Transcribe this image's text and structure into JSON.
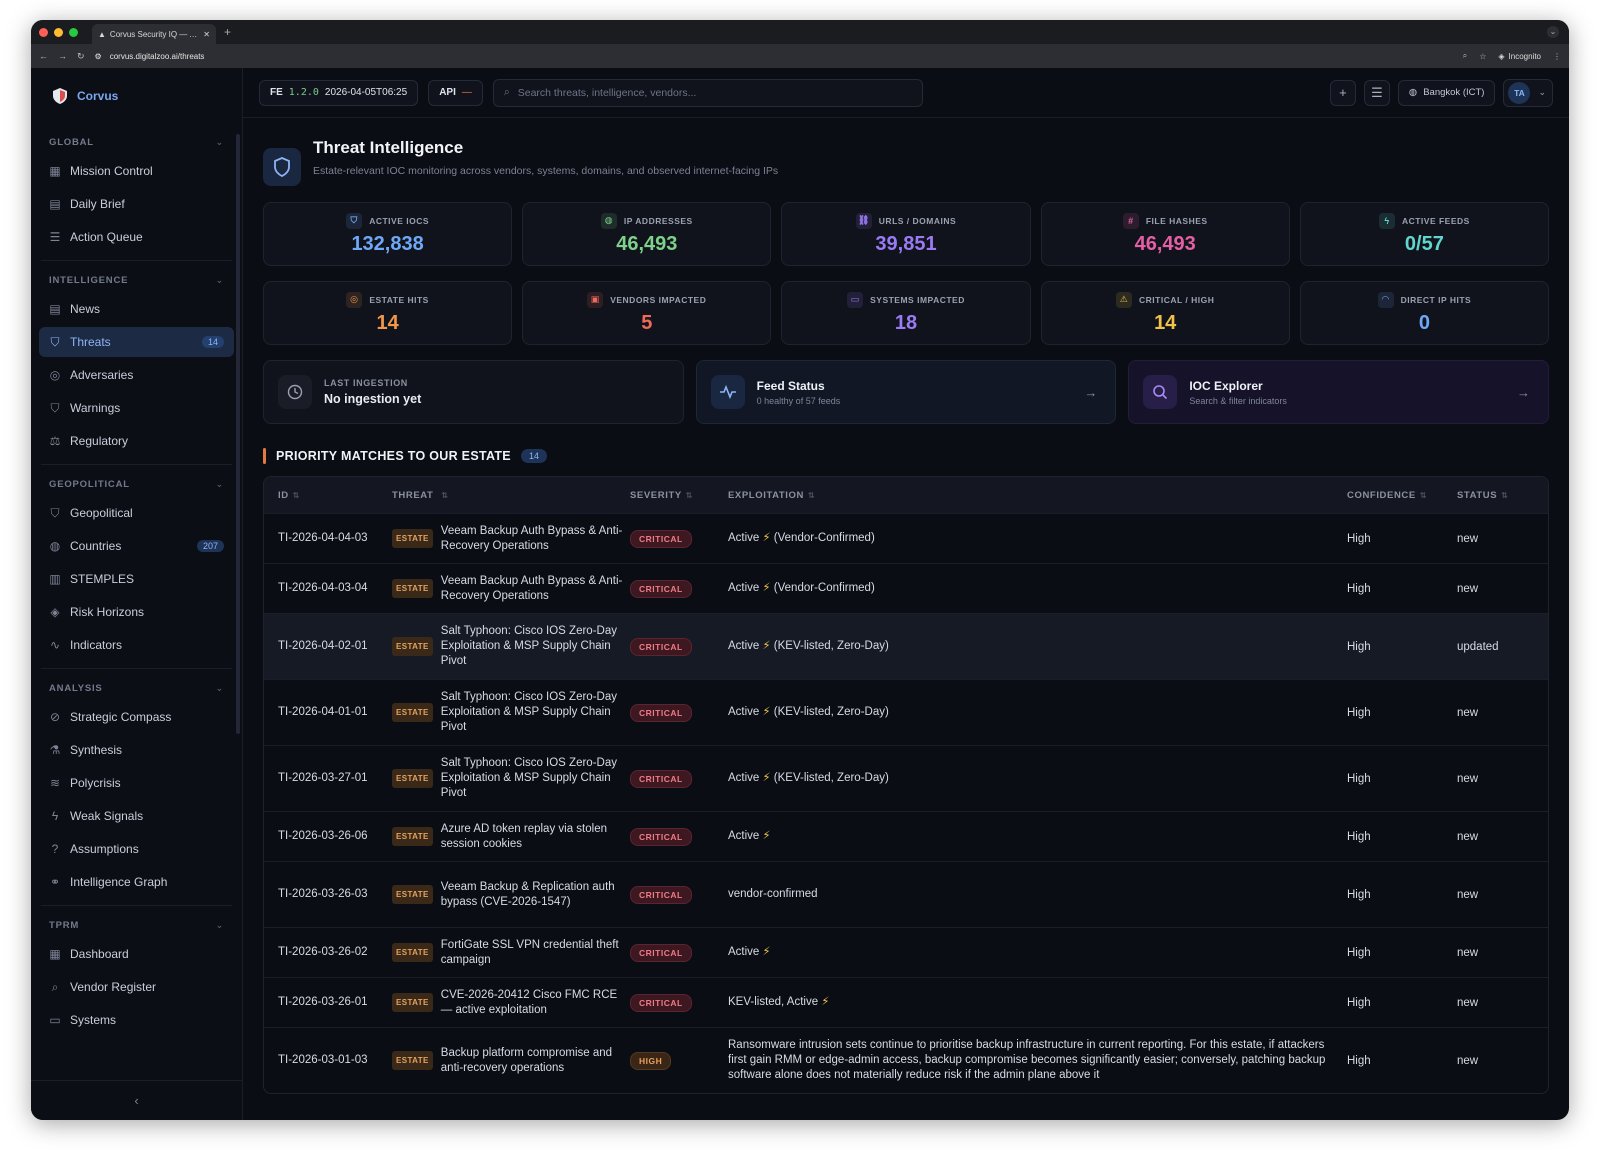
{
  "browser": {
    "tab_title": "Corvus Security IQ — AI-Pow...",
    "url": "corvus.digitalzoo.ai/threats",
    "incognito": "Incognito"
  },
  "brand": {
    "name": "Corvus"
  },
  "sidebar": {
    "sections": [
      {
        "title": "GLOBAL",
        "items": [
          {
            "label": "Mission Control",
            "icon": "grid-icon"
          },
          {
            "label": "Daily Brief",
            "icon": "document-icon"
          },
          {
            "label": "Action Queue",
            "icon": "list-icon"
          }
        ]
      },
      {
        "title": "INTELLIGENCE",
        "items": [
          {
            "label": "News",
            "icon": "newspaper-icon"
          },
          {
            "label": "Threats",
            "icon": "shield-icon",
            "badge": "14",
            "active": true
          },
          {
            "label": "Adversaries",
            "icon": "target-icon"
          },
          {
            "label": "Warnings",
            "icon": "shield-alert-icon"
          },
          {
            "label": "Regulatory",
            "icon": "scale-icon"
          }
        ]
      },
      {
        "title": "GEOPOLITICAL",
        "items": [
          {
            "label": "Geopolitical",
            "icon": "shield-icon"
          },
          {
            "label": "Countries",
            "icon": "globe-icon",
            "badge": "207"
          },
          {
            "label": "STEMPLES",
            "icon": "bar-chart-icon"
          },
          {
            "label": "Risk Horizons",
            "icon": "layers-icon"
          },
          {
            "label": "Indicators",
            "icon": "activity-icon"
          }
        ]
      },
      {
        "title": "ANALYSIS",
        "items": [
          {
            "label": "Strategic Compass",
            "icon": "compass-icon"
          },
          {
            "label": "Synthesis",
            "icon": "flask-icon"
          },
          {
            "label": "Polycrisis",
            "icon": "waves-icon"
          },
          {
            "label": "Weak Signals",
            "icon": "zap-icon"
          },
          {
            "label": "Assumptions",
            "icon": "help-circle-icon"
          },
          {
            "label": "Intelligence Graph",
            "icon": "network-icon"
          }
        ]
      },
      {
        "title": "TPRM",
        "items": [
          {
            "label": "Dashboard",
            "icon": "grid-icon"
          },
          {
            "label": "Vendor Register",
            "icon": "search-icon"
          },
          {
            "label": "Systems",
            "icon": "monitor-icon"
          }
        ]
      }
    ],
    "collapse_label": "‹"
  },
  "topbar": {
    "fe_label": "FE",
    "fe_version": "1.2.0",
    "fe_timestamp": "2026-04-05T06:25",
    "api_label": "API",
    "api_status": "—",
    "search_placeholder": "Search threats, intelligence, vendors...",
    "timezone": "Bangkok (ICT)",
    "user_initials": "TA"
  },
  "page": {
    "title": "Threat Intelligence",
    "subtitle": "Estate-relevant IOC monitoring across vendors, systems, domains, and observed internet-facing IPs"
  },
  "stats_row1": [
    {
      "label": "ACTIVE IOCS",
      "value": "132,838",
      "color": "#6ea8f7",
      "icon": "shield-icon"
    },
    {
      "label": "IP ADDRESSES",
      "value": "46,493",
      "color": "#7ed08b",
      "icon": "globe-icon"
    },
    {
      "label": "URLS / DOMAINS",
      "value": "39,851",
      "color": "#9b7bf5",
      "icon": "link-icon"
    },
    {
      "label": "FILE HASHES",
      "value": "46,493",
      "color": "#e45fa4",
      "icon": "hash-icon"
    },
    {
      "label": "ACTIVE FEEDS",
      "value": "0/57",
      "color": "#5fd6cf",
      "icon": "zap-icon"
    }
  ],
  "stats_row2": [
    {
      "label": "ESTATE HITS",
      "value": "14",
      "color": "#f2964b",
      "icon": "target-icon"
    },
    {
      "label": "VENDORS IMPACTED",
      "value": "5",
      "color": "#ef6a5a",
      "icon": "building-icon"
    },
    {
      "label": "SYSTEMS IMPACTED",
      "value": "18",
      "color": "#9b7bf5",
      "icon": "monitor-icon"
    },
    {
      "label": "CRITICAL / HIGH",
      "value": "14",
      "color": "#f0c24a",
      "icon": "warning-icon"
    },
    {
      "label": "DIRECT IP HITS",
      "value": "0",
      "color": "#6ea8f7",
      "icon": "wifi-icon"
    }
  ],
  "cards": {
    "ingestion": {
      "label": "LAST INGESTION",
      "value": "No ingestion yet"
    },
    "feed": {
      "title": "Feed Status",
      "subtitle": "0 healthy of 57 feeds"
    },
    "ioc": {
      "title": "IOC Explorer",
      "subtitle": "Search & filter indicators"
    }
  },
  "priority": {
    "title": "PRIORITY MATCHES TO OUR ESTATE",
    "count": "14",
    "columns": [
      "ID",
      "THREAT",
      "SEVERITY",
      "EXPLOITATION",
      "CONFIDENCE",
      "STATUS"
    ],
    "estate_tag": "ESTATE",
    "rows": [
      {
        "id": "TI-2026-04-04-03",
        "threat": "Veeam Backup Auth Bypass & Anti-Recovery Operations",
        "severity": "CRITICAL",
        "exploit": "Active ⚡ (Vendor-Confirmed)",
        "confidence": "High",
        "status": "new"
      },
      {
        "id": "TI-2026-04-03-04",
        "threat": "Veeam Backup Auth Bypass & Anti-Recovery Operations",
        "severity": "CRITICAL",
        "exploit": "Active ⚡ (Vendor-Confirmed)",
        "confidence": "High",
        "status": "new"
      },
      {
        "id": "TI-2026-04-02-01",
        "threat": "Salt Typhoon: Cisco IOS Zero-Day Exploitation & MSP Supply Chain Pivot",
        "severity": "CRITICAL",
        "exploit": "Active ⚡ (KEV-listed, Zero-Day)",
        "confidence": "High",
        "status": "updated"
      },
      {
        "id": "TI-2026-04-01-01",
        "threat": "Salt Typhoon: Cisco IOS Zero-Day Exploitation & MSP Supply Chain Pivot",
        "severity": "CRITICAL",
        "exploit": "Active ⚡ (KEV-listed, Zero-Day)",
        "confidence": "High",
        "status": "new"
      },
      {
        "id": "TI-2026-03-27-01",
        "threat": "Salt Typhoon: Cisco IOS Zero-Day Exploitation & MSP Supply Chain Pivot",
        "severity": "CRITICAL",
        "exploit": "Active ⚡ (KEV-listed, Zero-Day)",
        "confidence": "High",
        "status": "new"
      },
      {
        "id": "TI-2026-03-26-06",
        "threat": "Azure AD token replay via stolen session cookies",
        "severity": "CRITICAL",
        "exploit": "Active ⚡",
        "confidence": "High",
        "status": "new"
      },
      {
        "id": "TI-2026-03-26-03",
        "threat": "Veeam Backup & Replication auth bypass (CVE-2026-1547)",
        "severity": "CRITICAL",
        "exploit": "vendor-confirmed",
        "confidence": "High",
        "status": "new"
      },
      {
        "id": "TI-2026-03-26-02",
        "threat": "FortiGate SSL VPN credential theft campaign",
        "severity": "CRITICAL",
        "exploit": "Active ⚡",
        "confidence": "High",
        "status": "new"
      },
      {
        "id": "TI-2026-03-26-01",
        "threat": "CVE-2026-20412 Cisco FMC RCE — active exploitation",
        "severity": "CRITICAL",
        "exploit": "KEV-listed, Active ⚡",
        "confidence": "High",
        "status": "new"
      },
      {
        "id": "TI-2026-03-01-03",
        "threat": "Backup platform compromise and anti-recovery operations",
        "severity": "HIGH",
        "exploit": "Ransomware intrusion sets continue to prioritise backup infrastructure in current reporting. For this estate, if attackers first gain RMM or edge-admin access, backup compromise becomes significantly easier; conversely, patching backup software alone does not materially reduce risk if the admin plane above it",
        "confidence": "High",
        "status": "new"
      }
    ]
  }
}
